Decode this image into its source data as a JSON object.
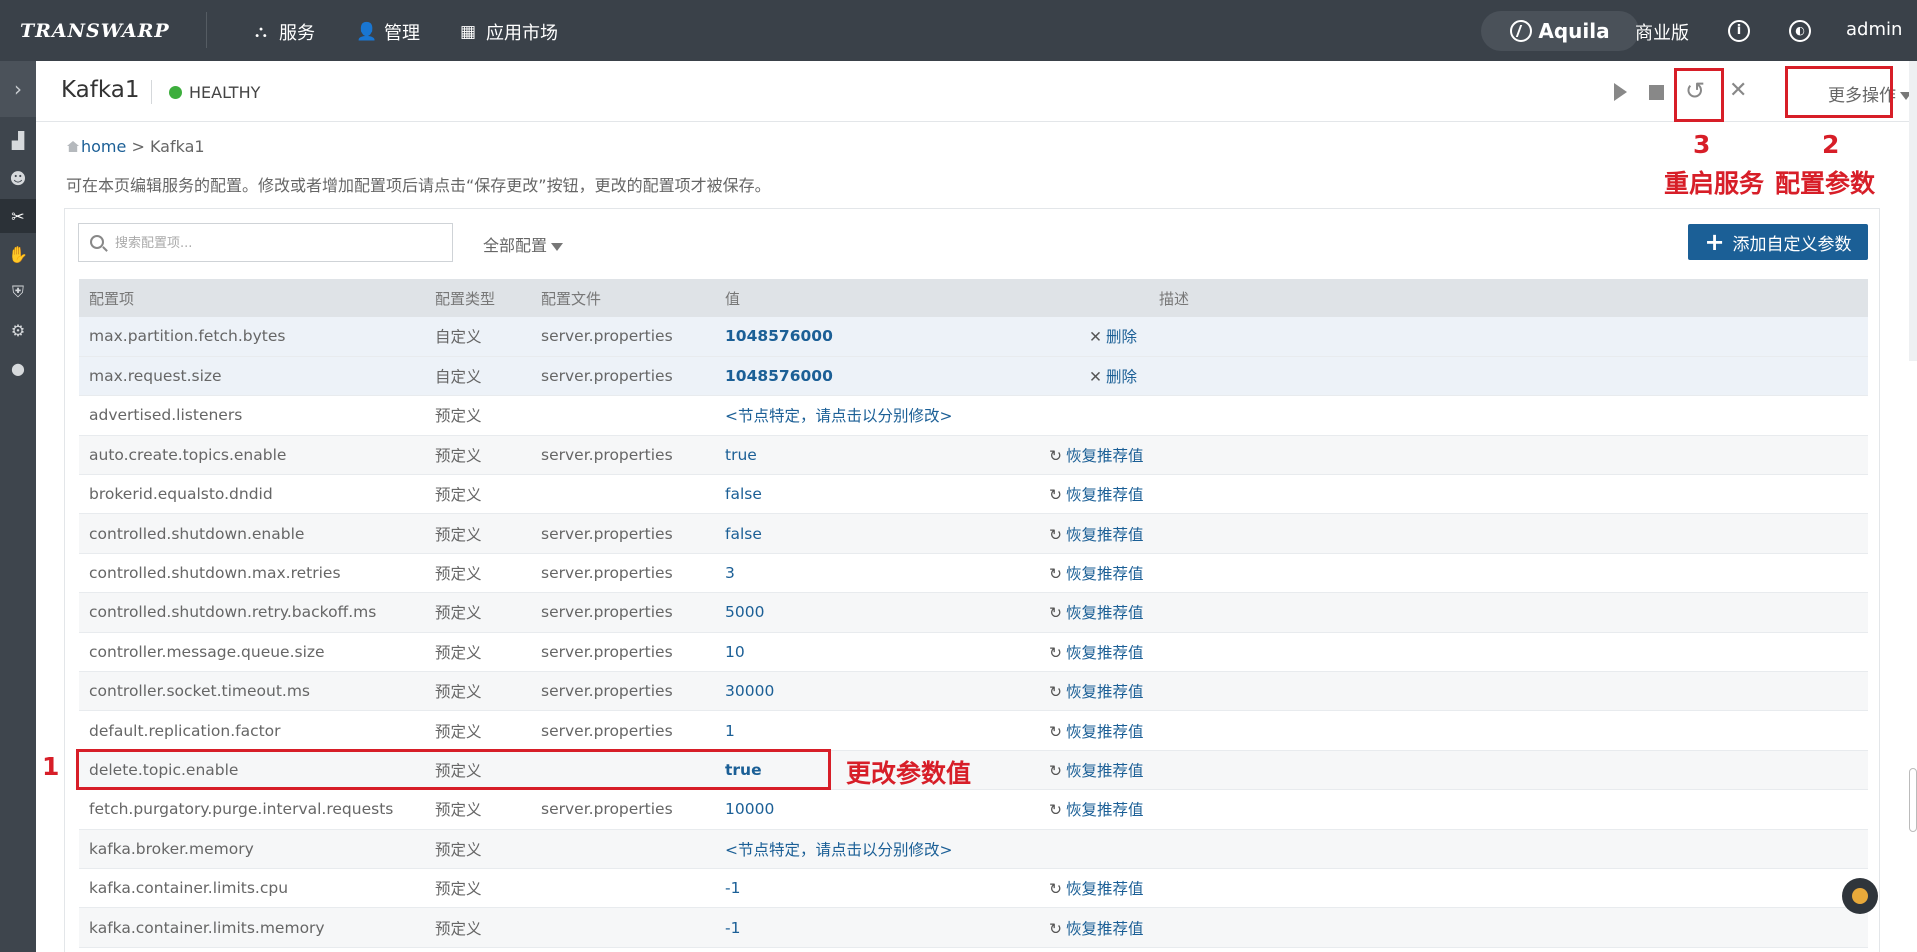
{
  "topbar": {
    "logo": "TRANSWARP",
    "nav": [
      {
        "label": "服务",
        "icon": "cluster-icon"
      },
      {
        "label": "管理",
        "icon": "user-icon"
      },
      {
        "label": "应用市场",
        "icon": "apps-grid-icon"
      }
    ],
    "product": "Aquila",
    "edition": "商业版",
    "user": "admin"
  },
  "sidebar": {
    "items": [
      "dashboard-chart-icon",
      "mask-icon",
      "tools-icon",
      "hand-icon",
      "shield-icon",
      "gears-icon",
      "person-icon"
    ],
    "active_index": 2
  },
  "service": {
    "name": "Kafka1",
    "status": "HEALTHY",
    "status_color": "#3dae3d",
    "more_actions": "更多操作"
  },
  "breadcrumb": {
    "home": "home",
    "separator": ">",
    "current": "Kafka1"
  },
  "description": "可在本页编辑服务的配置。修改或者增加配置项后请点击“保存更改”按钮，更改的配置项才被保存。",
  "toolbar": {
    "search_placeholder": "搜索配置项...",
    "filter_label": "全部配置",
    "add_button": "添加自定义参数"
  },
  "table": {
    "columns": [
      "配置项",
      "配置类型",
      "配置文件",
      "值",
      "",
      "描述"
    ],
    "rows": [
      {
        "key": "max.partition.fetch.bytes",
        "type": "自定义",
        "file": "server.properties",
        "value": "1048576000",
        "action": "删除",
        "bold": true,
        "hl": true
      },
      {
        "key": "max.request.size",
        "type": "自定义",
        "file": "server.properties",
        "value": "1048576000",
        "action": "删除",
        "bold": true,
        "hl": true
      },
      {
        "key": "advertised.listeners",
        "type": "预定义",
        "file": "",
        "value": "<节点特定，请点击以分别修改>",
        "action": "",
        "bold": false
      },
      {
        "key": "auto.create.topics.enable",
        "type": "预定义",
        "file": "server.properties",
        "value": "true",
        "action": "恢复推荐值",
        "bold": false
      },
      {
        "key": "brokerid.equalsto.dndid",
        "type": "预定义",
        "file": "",
        "value": "false",
        "action": "恢复推荐值",
        "bold": false
      },
      {
        "key": "controlled.shutdown.enable",
        "type": "预定义",
        "file": "server.properties",
        "value": "false",
        "action": "恢复推荐值",
        "bold": false
      },
      {
        "key": "controlled.shutdown.max.retries",
        "type": "预定义",
        "file": "server.properties",
        "value": "3",
        "action": "恢复推荐值",
        "bold": false
      },
      {
        "key": "controlled.shutdown.retry.backoff.ms",
        "type": "预定义",
        "file": "server.properties",
        "value": "5000",
        "action": "恢复推荐值",
        "bold": false
      },
      {
        "key": "controller.message.queue.size",
        "type": "预定义",
        "file": "server.properties",
        "value": "10",
        "action": "恢复推荐值",
        "bold": false
      },
      {
        "key": "controller.socket.timeout.ms",
        "type": "预定义",
        "file": "server.properties",
        "value": "30000",
        "action": "恢复推荐值",
        "bold": false
      },
      {
        "key": "default.replication.factor",
        "type": "预定义",
        "file": "server.properties",
        "value": "1",
        "action": "恢复推荐值",
        "bold": false
      },
      {
        "key": "delete.topic.enable",
        "type": "预定义",
        "file": "",
        "value": "true",
        "action": "恢复推荐值",
        "bold": true
      },
      {
        "key": "fetch.purgatory.purge.interval.requests",
        "type": "预定义",
        "file": "server.properties",
        "value": "10000",
        "action": "恢复推荐值",
        "bold": false
      },
      {
        "key": "kafka.broker.memory",
        "type": "预定义",
        "file": "",
        "value": "<节点特定，请点击以分别修改>",
        "action": "",
        "bold": false
      },
      {
        "key": "kafka.container.limits.cpu",
        "type": "预定义",
        "file": "",
        "value": "-1",
        "action": "恢复推荐值",
        "bold": false
      },
      {
        "key": "kafka.container.limits.memory",
        "type": "预定义",
        "file": "",
        "value": "-1",
        "action": "恢复推荐值",
        "bold": false
      }
    ]
  },
  "annotations": {
    "n1": "1",
    "n2": "2",
    "n3": "3",
    "restart": "重启服务",
    "config": "配置参数",
    "change_value": "更改参数值",
    "color": "#d71e28"
  }
}
